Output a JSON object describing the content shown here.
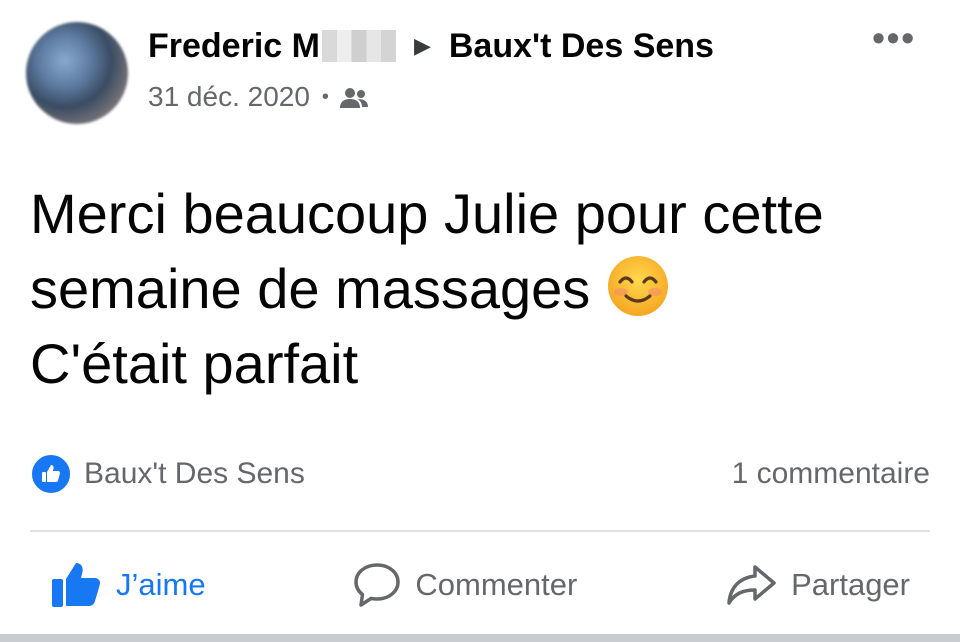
{
  "post": {
    "author": "Frederic M",
    "group": "Baux't Des Sens",
    "date": "31 déc. 2020",
    "dot": "•",
    "arrow": "▶",
    "more": "•••",
    "text_lines": [
      "Merci beaucoup Julie pour cette",
      "semaine de massages",
      "C'était parfait"
    ],
    "audience_icon": "group-icon",
    "emoji": "smiling-face-with-smiling-eyes"
  },
  "reactions": {
    "liked_by": "Baux't Des Sens",
    "comments_count": "1 commentaire"
  },
  "actions": {
    "like_label": "J’aime",
    "comment_label": "Commenter",
    "share_label": "Partager"
  },
  "colors": {
    "accent": "#1877f2",
    "secondary_text": "#65676b",
    "divider": "#dddfe2"
  }
}
